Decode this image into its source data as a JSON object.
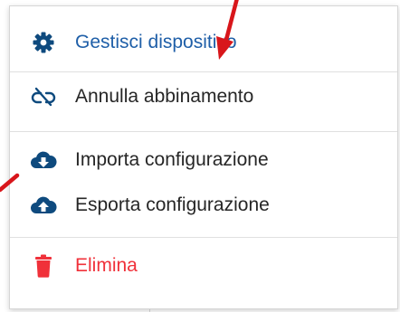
{
  "menu": {
    "manage": {
      "label": "Gestisci dispositivo",
      "icon": "gear-icon"
    },
    "unpair": {
      "label": "Annulla abbinamento",
      "icon": "unlink-icon"
    },
    "import": {
      "label": "Importa configurazione",
      "icon": "cloud-download-icon"
    },
    "export": {
      "label": "Esporta configurazione",
      "icon": "cloud-upload-icon"
    },
    "delete": {
      "label": "Elimina",
      "icon": "trash-icon"
    }
  },
  "colors": {
    "primary_blue": "#1f5fa8",
    "icon_navy": "#0e4a7e",
    "danger_red": "#f0313a",
    "annotation_red": "#d8161b"
  }
}
